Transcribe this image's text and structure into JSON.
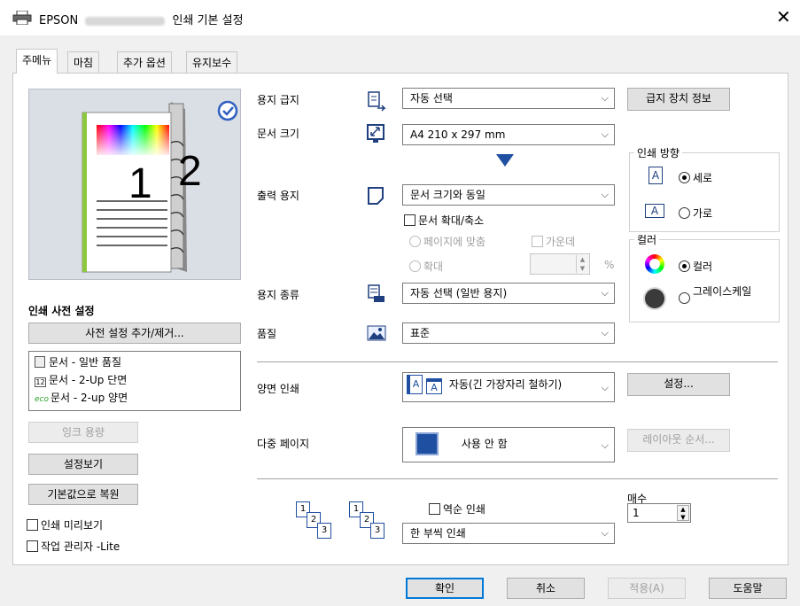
{
  "window": {
    "app_name": "EPSON",
    "title": "인쇄 기본 설정",
    "close_label": "✕"
  },
  "tabs": [
    {
      "label": "주메뉴",
      "active": true
    },
    {
      "label": "마침",
      "active": false
    },
    {
      "label": "추가 옵션",
      "active": false
    },
    {
      "label": "유지보수",
      "active": false
    }
  ],
  "preview": {
    "page_left_number": "1",
    "page_right_number": "2"
  },
  "presets": {
    "heading": "인쇄 사전 설정",
    "add_remove_button": "사전 설정 추가/제거...",
    "items": [
      {
        "label": "문서 - 일반 품질",
        "icon": "document-icon"
      },
      {
        "label": "문서 - 2-Up 단면",
        "icon": "two-up-icon"
      },
      {
        "label": "문서 - 2-up 양면",
        "icon": "eco-icon",
        "icon_text": "eco"
      }
    ]
  },
  "left_buttons": {
    "ink_levels": "잉크 용량",
    "show_settings": "설정보기",
    "restore_defaults": "기본값으로 복원"
  },
  "left_checkboxes": {
    "print_preview": "인쇄 미리보기",
    "job_manager": "작업 관리자 -Lite"
  },
  "paper_source": {
    "label": "용지 급지",
    "value": "자동 선택",
    "info_button": "급지 장치 정보"
  },
  "document_size": {
    "label": "문서 크기",
    "value": "A4 210 x 297 mm"
  },
  "output_paper": {
    "label": "출력 용지",
    "value": "문서 크기와 동일",
    "reduce_enlarge": "문서 확대/축소",
    "fit_to_page": "페이지에 맞춤",
    "center": "가운데",
    "zoom_to": "확대",
    "percent_symbol": "%"
  },
  "orientation": {
    "title": "인쇄 방향",
    "portrait": "세로",
    "landscape": "가로",
    "icon_letter": "A"
  },
  "color": {
    "title": "컬러",
    "color_option": "컬러",
    "grayscale_option": "그레이스케일"
  },
  "paper_type": {
    "label": "용지 종류",
    "value": "자동 선택 (일반 용지)"
  },
  "quality": {
    "label": "품질",
    "value": "표준"
  },
  "two_sided": {
    "label": "양면 인쇄",
    "value": "자동(긴 가장자리 철하기)",
    "settings_button": "설정...",
    "icon_letter": "A"
  },
  "multi_page": {
    "label": "다중 페이지",
    "value": "사용 안 함",
    "layout_order_button": "레이아웃 순서..."
  },
  "order": {
    "reverse_order": "역순 인쇄",
    "collate_value": "한 부씩 인쇄",
    "stack_numbers": [
      "1",
      "2",
      "3"
    ]
  },
  "copies": {
    "label": "매수",
    "value": "1"
  },
  "footer": {
    "ok": "확인",
    "cancel": "취소",
    "apply": "적용(A)",
    "help": "도움말"
  }
}
